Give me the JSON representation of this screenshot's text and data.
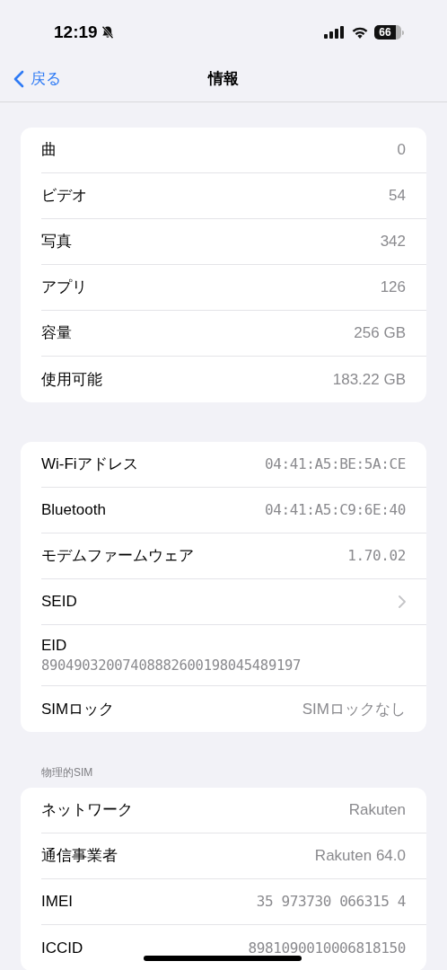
{
  "status_bar": {
    "time": "12:19",
    "battery": "66"
  },
  "nav": {
    "back": "戻る",
    "title": "情報"
  },
  "groups": [
    {
      "rows": [
        {
          "kind": "value",
          "label": "曲",
          "value": "0"
        },
        {
          "kind": "value",
          "label": "ビデオ",
          "value": "54"
        },
        {
          "kind": "value",
          "label": "写真",
          "value": "342"
        },
        {
          "kind": "value",
          "label": "アプリ",
          "value": "126"
        },
        {
          "kind": "value",
          "label": "容量",
          "value": "256 GB"
        },
        {
          "kind": "value",
          "label": "使用可能",
          "value": "183.22 GB"
        }
      ]
    },
    {
      "rows": [
        {
          "kind": "mono",
          "label": "Wi-Fiアドレス",
          "value": "04:41:A5:BE:5A:CE"
        },
        {
          "kind": "mono",
          "label": "Bluetooth",
          "value": "04:41:A5:C9:6E:40"
        },
        {
          "kind": "mono",
          "label": "モデムファームウェア",
          "value": "1.70.02"
        },
        {
          "kind": "chevron",
          "label": "SEID"
        },
        {
          "kind": "stacked",
          "label": "EID",
          "value": "89049032007408882600198045489197"
        },
        {
          "kind": "value",
          "label": "SIMロック",
          "value": "SIMロックなし"
        }
      ]
    },
    {
      "header": "物理的SIM",
      "rows": [
        {
          "kind": "value",
          "label": "ネットワーク",
          "value": "Rakuten"
        },
        {
          "kind": "value",
          "label": "通信事業者",
          "value": "Rakuten 64.0"
        },
        {
          "kind": "mono",
          "label": "IMEI",
          "value": "35 973730 066315 4"
        },
        {
          "kind": "mono",
          "label": "ICCID",
          "value": "8981090010006818150"
        }
      ]
    }
  ]
}
